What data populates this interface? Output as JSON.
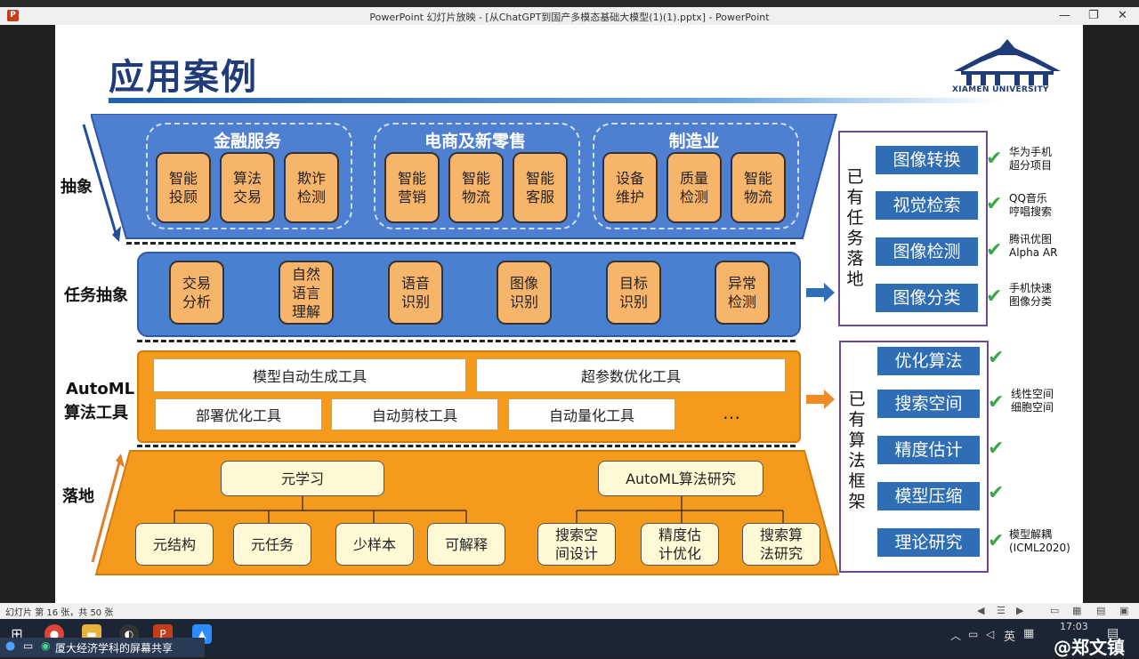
{
  "window": {
    "title": "PowerPoint 幻灯片放映 - [从ChatGPT到国产多模态基础大模型(1)(1).pptx] - PowerPoint",
    "minimize_glyph": "—",
    "restore_glyph": "❐",
    "close_glyph": "✕"
  },
  "slide": {
    "title": "应用案例",
    "logo_text": "XIAMEN UNIVERSITY",
    "side_labels": {
      "abstract": "抽象",
      "task_abstract": "任务抽象",
      "automl_line1": "AutoML",
      "automl_line2": "算法工具",
      "landing": "落地"
    },
    "top_groups": [
      {
        "label": "金融服务",
        "items": [
          "智能\n投顾",
          "算法\n交易",
          "欺诈\n检测"
        ]
      },
      {
        "label": "电商及新零售",
        "items": [
          "智能\n营销",
          "智能\n物流",
          "智能\n客服"
        ]
      },
      {
        "label": "制造业",
        "items": [
          "设备\n维护",
          "质量\n检测",
          "智能\n物流"
        ]
      }
    ],
    "tasks": [
      "交易\n分析",
      "自然\n语言\n理解",
      "语音\n识别",
      "图像\n识别",
      "目标\n识别",
      "异常\n检测"
    ],
    "tools_row1": [
      "模型自动生成工具",
      "超参数优化工具"
    ],
    "tools_row2": [
      "部署优化工具",
      "自动剪枝工具",
      "自动量化工具"
    ],
    "tools_more": "…",
    "landing_top": [
      "元学习",
      "AutoML算法研究"
    ],
    "landing_bottom": [
      "元结构",
      "元任务",
      "少样本",
      "可解释",
      "搜索空\n间设计",
      "精度估\n计优化",
      "搜索算\n法研究"
    ],
    "right_tasks": {
      "vertical_label": [
        "已",
        "有",
        "任",
        "务",
        "落",
        "地"
      ],
      "items": [
        {
          "label": "图像转换",
          "note": "华为手机\n超分项目"
        },
        {
          "label": "视觉检索",
          "note": "QQ音乐\n哼唱搜索"
        },
        {
          "label": "图像检测",
          "note": "腾讯优图\nAlpha AR"
        },
        {
          "label": "图像分类",
          "note": "手机快速\n图像分类"
        }
      ]
    },
    "right_algos": {
      "vertical_label": [
        "已",
        "有",
        "算",
        "法",
        "框",
        "架"
      ],
      "items": [
        {
          "label": "优化算法",
          "note": ""
        },
        {
          "label": "搜索空间",
          "note": "线性空间\n细胞空间"
        },
        {
          "label": "精度估计",
          "note": ""
        },
        {
          "label": "模型压缩",
          "note": ""
        },
        {
          "label": "理论研究",
          "note": "模型解耦\n(ICML2020)"
        }
      ]
    },
    "check_glyph": "✔"
  },
  "statusbar": {
    "text": "幻灯片 第 16 张，共 50 张"
  },
  "taskbar": {
    "share_text": "厦大经济学科的屏幕共享",
    "time": "17:03",
    "lang": "英",
    "watermark": "@郑文镇"
  },
  "colors": {
    "blue_trap": "#4f7fd1",
    "task_band": "#4a80d0",
    "orange": "#f59a1d",
    "accent_title": "#1f3b78",
    "check": "#3aa84a"
  }
}
